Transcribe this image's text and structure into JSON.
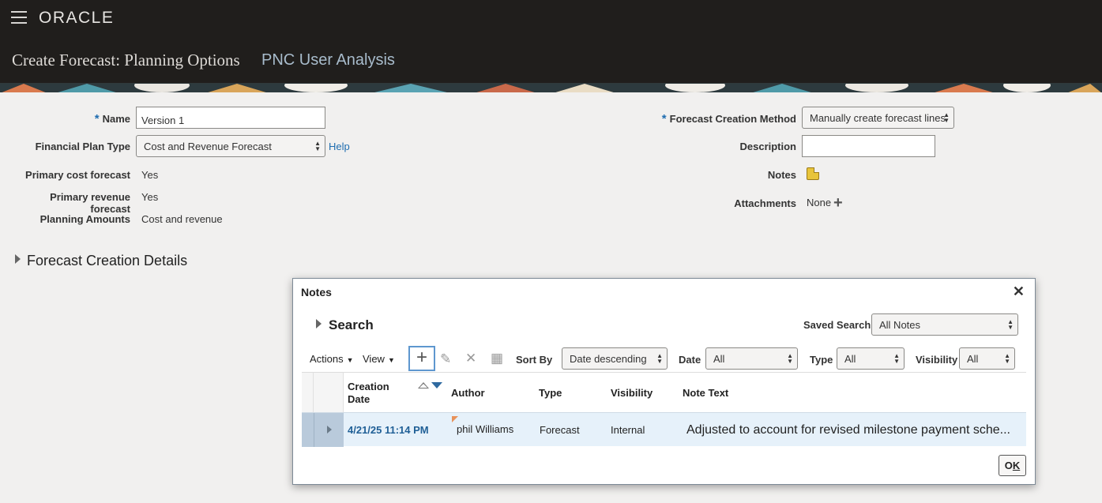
{
  "header": {
    "logo": "ORACLE",
    "title": "Create Forecast: Planning Options",
    "subtitle": "PNC User Analysis"
  },
  "form": {
    "name_label": "Name",
    "name_value": "Version 1",
    "plan_type_label": "Financial Plan Type",
    "plan_type_value": "Cost and Revenue Forecast",
    "help_link": "Help",
    "primary_cost_label": "Primary cost forecast",
    "primary_cost_value": "Yes",
    "primary_revenue_label": "Primary revenue forecast",
    "primary_revenue_value": "Yes",
    "planning_amounts_label": "Planning Amounts",
    "planning_amounts_value": "Cost and revenue",
    "method_label": "Forecast Creation Method",
    "method_value": "Manually create forecast lines",
    "description_label": "Description",
    "description_value": "",
    "notes_label": "Notes",
    "attachments_label": "Attachments",
    "attachments_value": "None"
  },
  "section": {
    "title": "Forecast Creation Details"
  },
  "dialog": {
    "title": "Notes",
    "close": "✕",
    "search_label": "Search",
    "saved_search_label": "Saved Search",
    "saved_search_value": "All Notes",
    "toolbar": {
      "actions": "Actions",
      "view": "View",
      "sort_by_label": "Sort By",
      "sort_by_value": "Date descending",
      "date_label": "Date",
      "date_value": "All",
      "type_label": "Type",
      "type_value": "All",
      "visibility_label": "Visibility",
      "visibility_value": "All"
    },
    "columns": {
      "creation_date_1": "Creation",
      "creation_date_2": "Date",
      "author": "Author",
      "type": "Type",
      "visibility": "Visibility",
      "note_text": "Note Text"
    },
    "rows": [
      {
        "creation_date": "4/21/25 11:14 PM",
        "author": "phil Williams",
        "type": "Forecast",
        "visibility": "Internal",
        "note_text": "Adjusted to account for revised milestone payment sche..."
      }
    ],
    "ok_label_1": "O",
    "ok_label_2": "K"
  },
  "colors": {
    "header_bg": "#201e1c",
    "link": "#1f6db0",
    "selected_row": "#e6f1fa"
  }
}
